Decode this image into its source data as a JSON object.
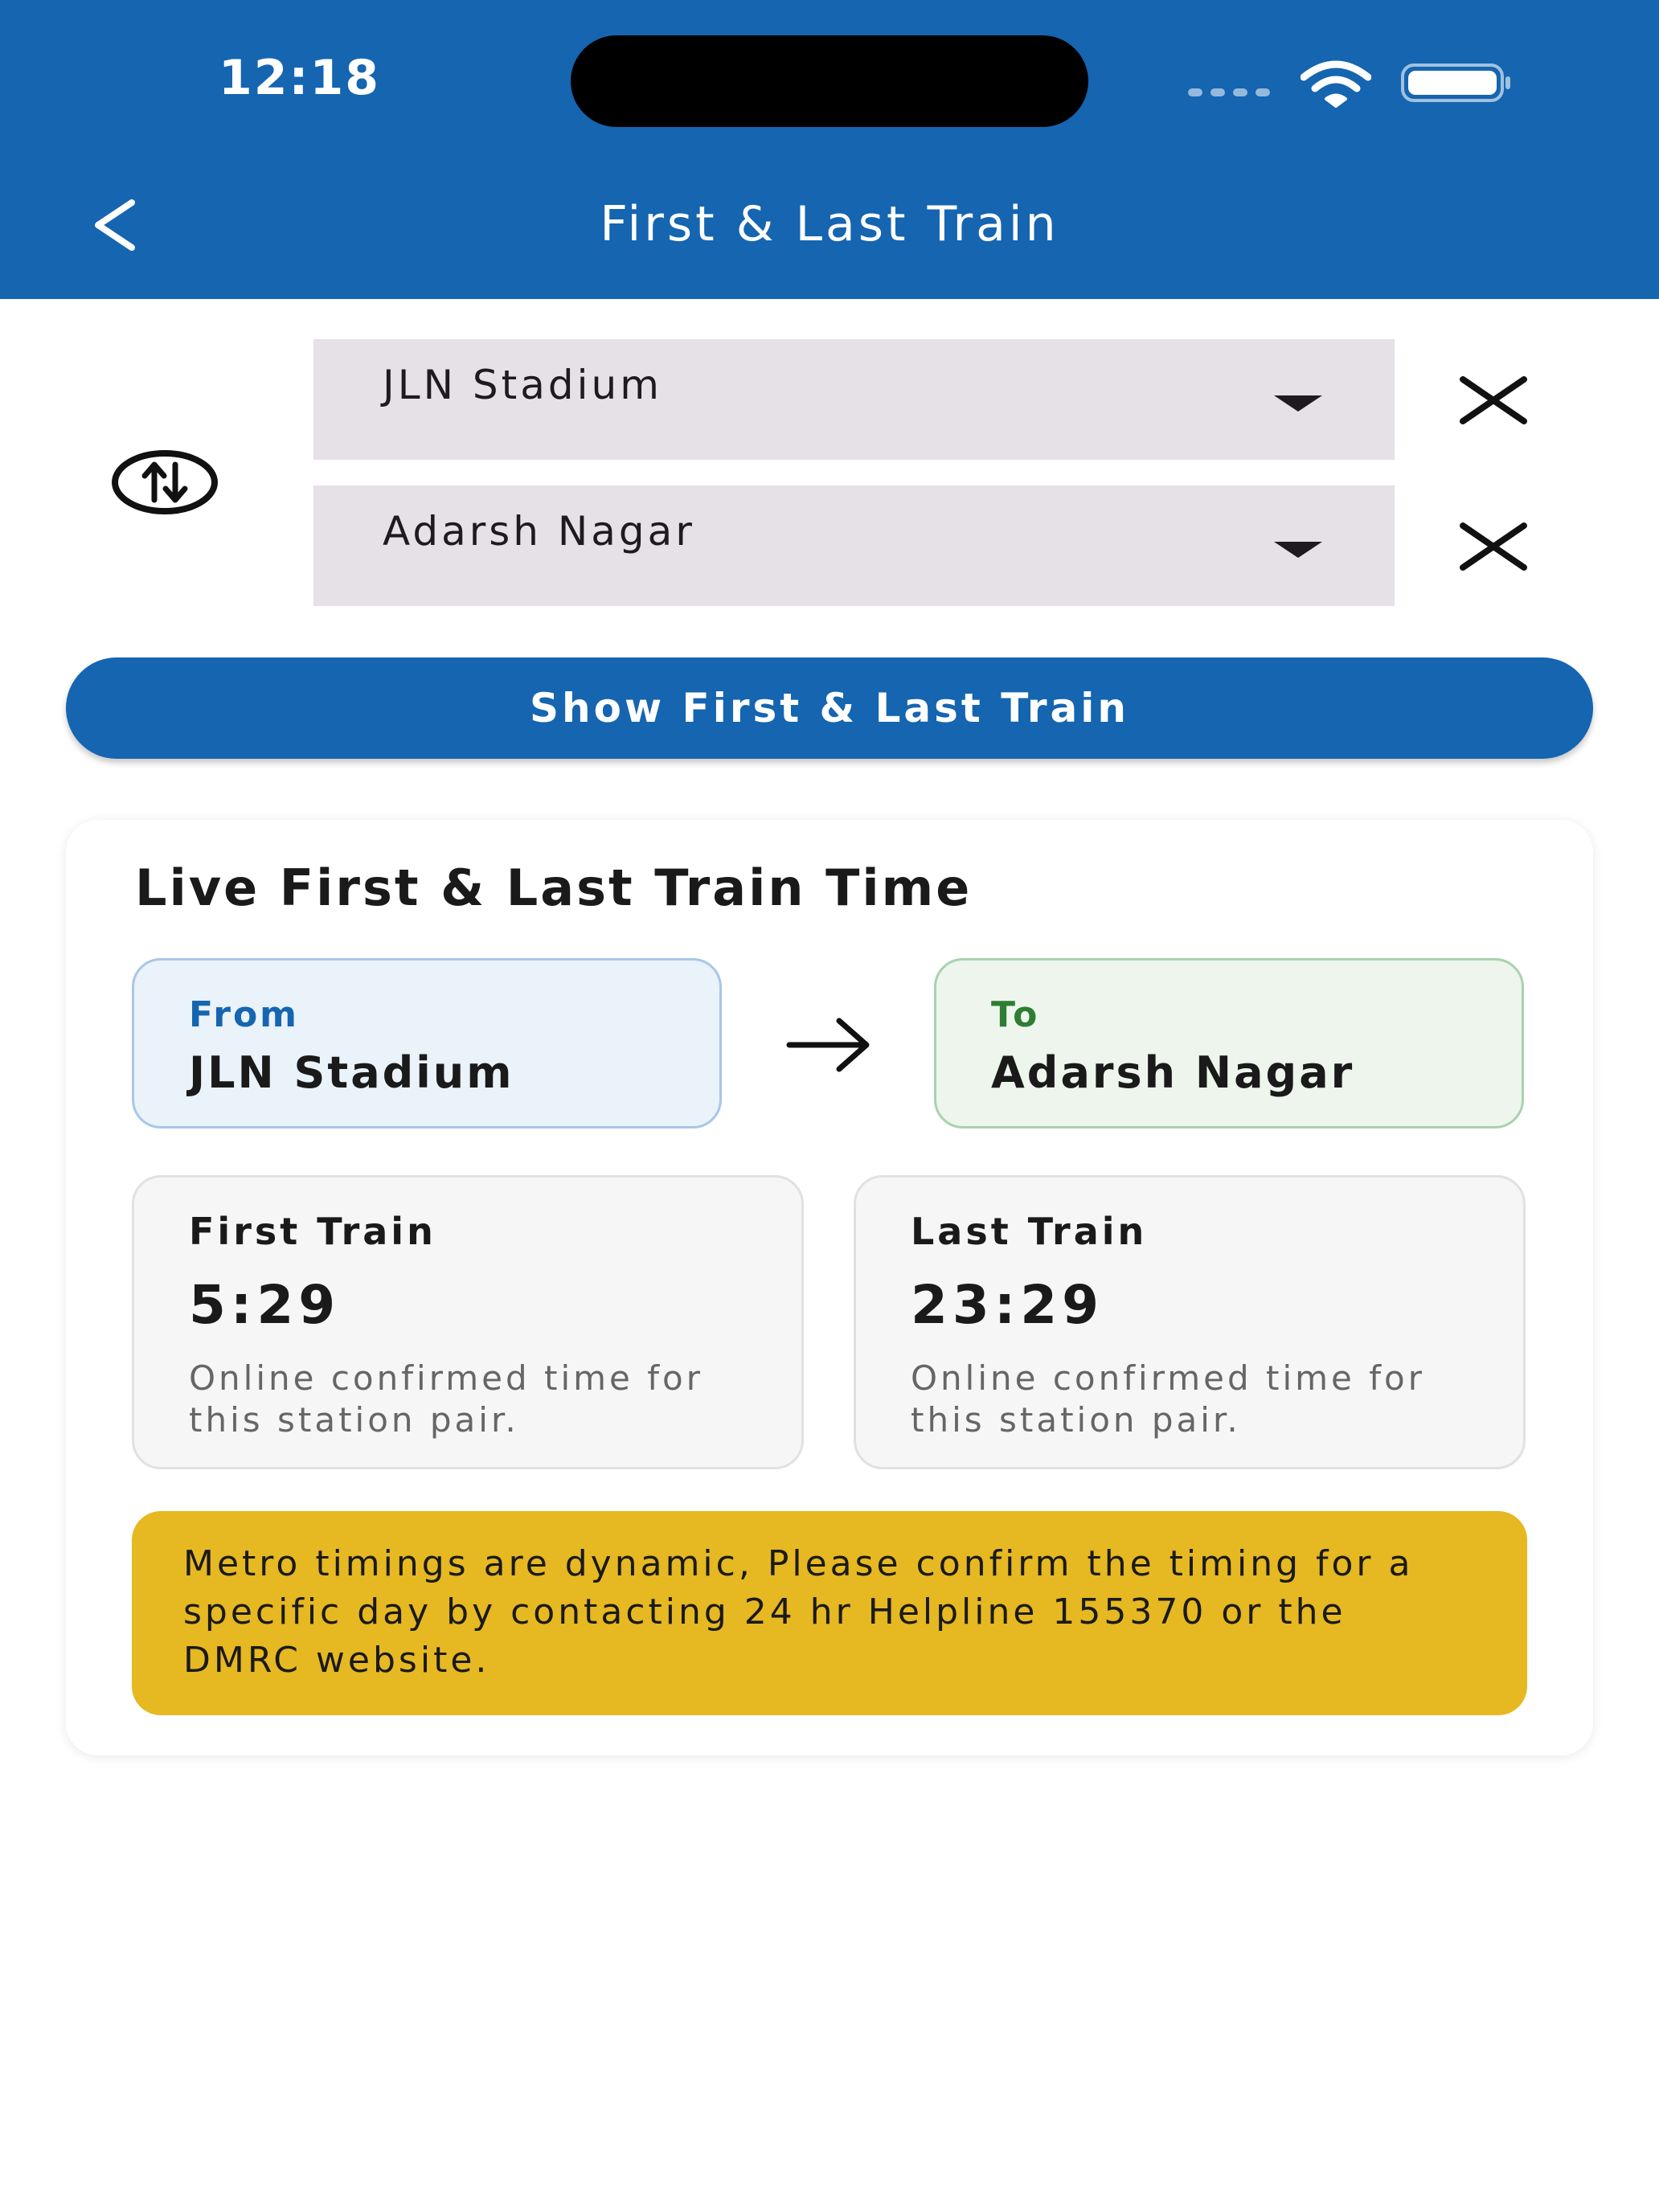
{
  "status_bar": {
    "time": "12:18"
  },
  "header": {
    "title": "First & Last Train",
    "back_icon": "chevron-left-icon"
  },
  "selectors": {
    "from_station": "JLN Stadium",
    "to_station": "Adarsh Nagar",
    "swap_icon": "swap-vertical-icon",
    "clear_icon": "close-icon",
    "dropdown_icon": "caret-down-icon"
  },
  "show_button": {
    "label": "Show First & Last Train"
  },
  "result": {
    "title": "Live First & Last Train Time",
    "from_label": "From",
    "from_station": "JLN Stadium",
    "to_label": "To",
    "to_station": "Adarsh Nagar",
    "first_train": {
      "label": "First Train",
      "time": "5:29",
      "note": "Online confirmed time for this station pair."
    },
    "last_train": {
      "label": "Last Train",
      "time": "23:29",
      "note": "Online confirmed time for this station pair."
    },
    "notice": "Metro timings are dynamic, Please confirm the timing for a specific day by contacting 24 hr Helpline 155370 or the DMRC website."
  },
  "colors": {
    "primary": "#1565b0",
    "dropdown_bg": "#e6e0e7",
    "from_bg": "#eaf2fa",
    "to_bg": "#edf5ed",
    "notice_bg": "#e6b822"
  }
}
